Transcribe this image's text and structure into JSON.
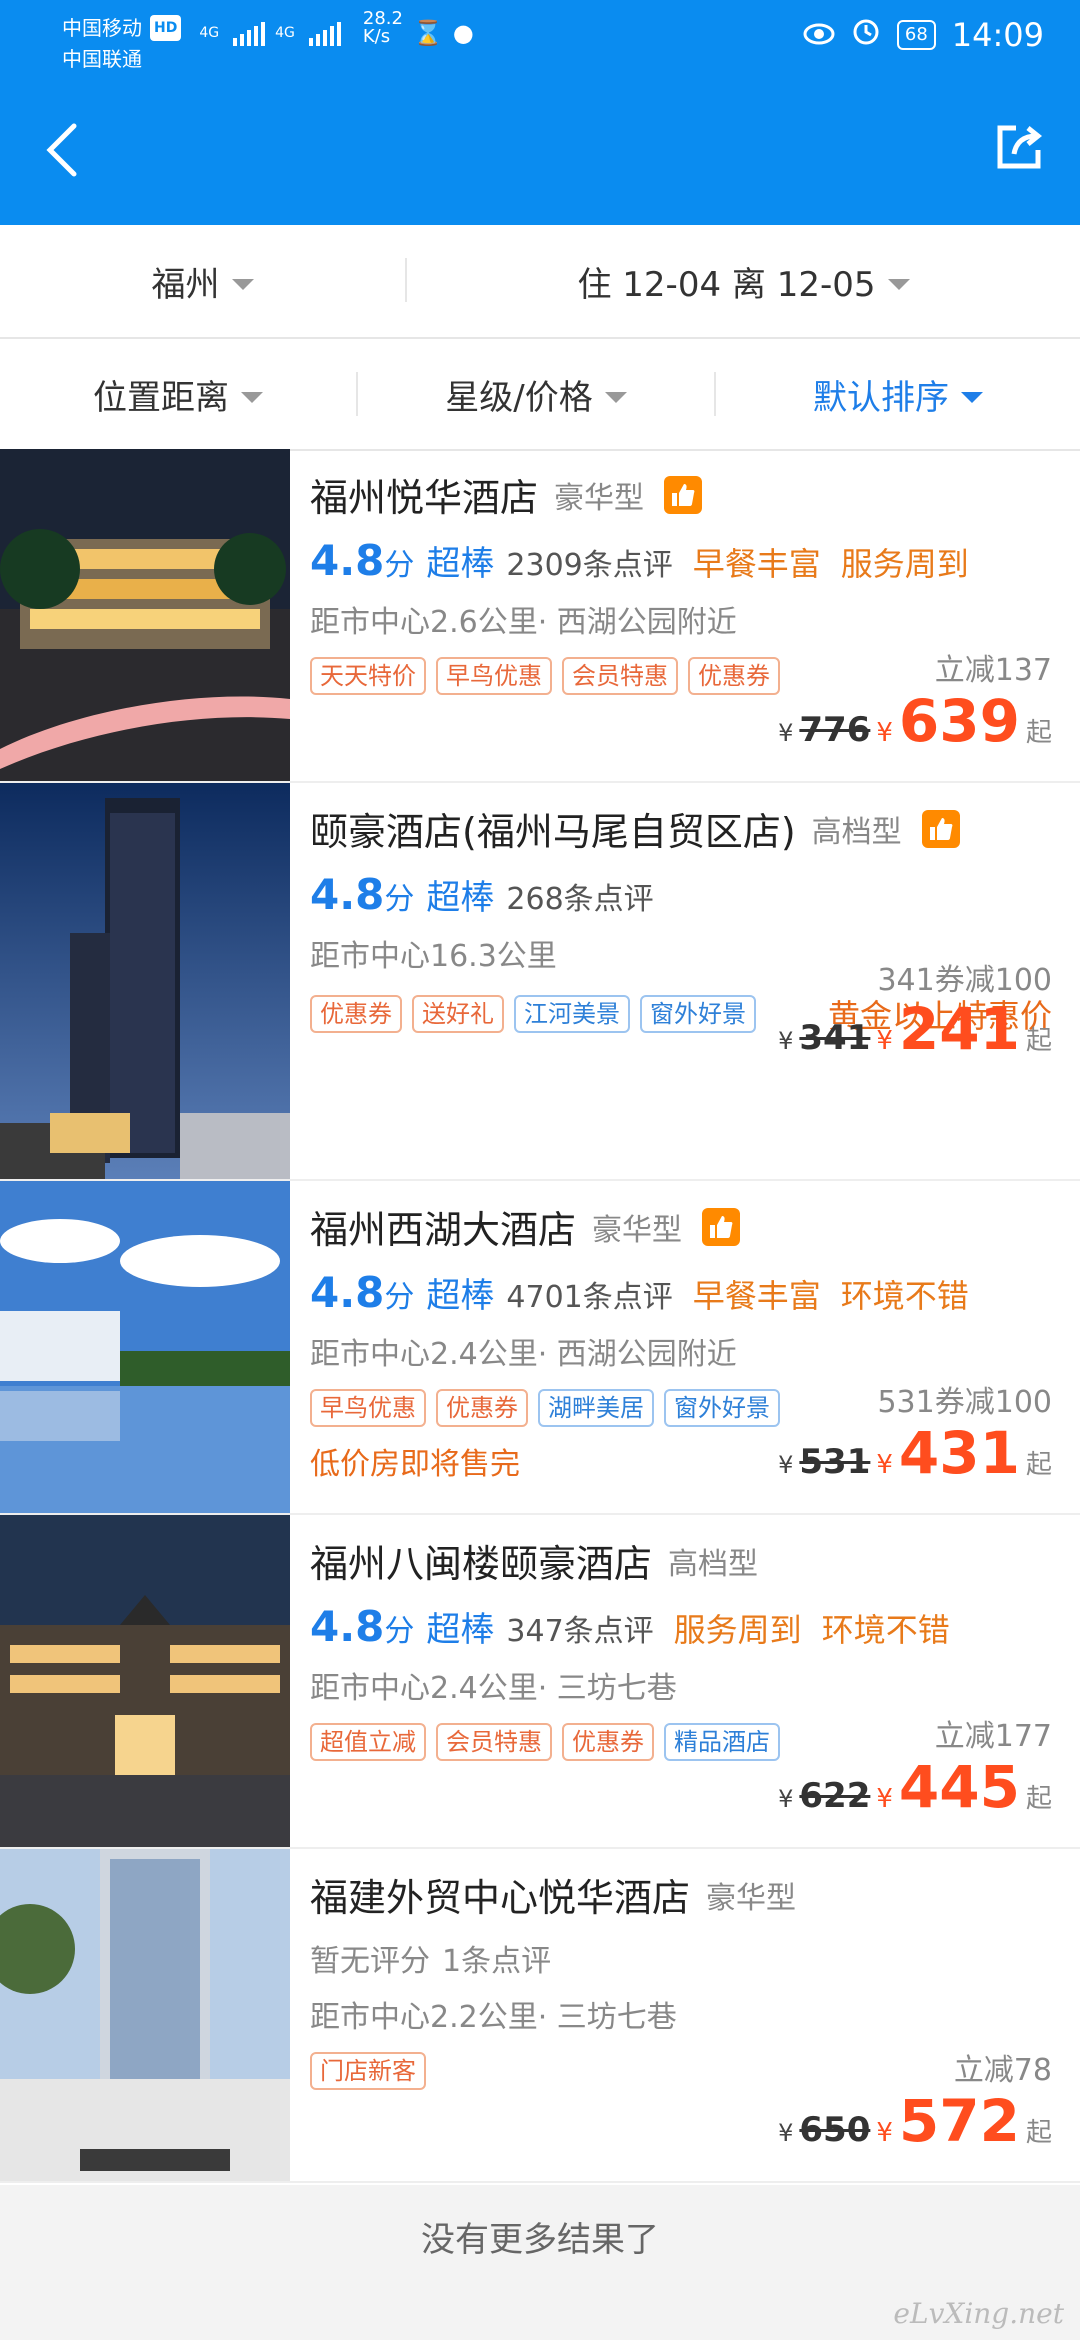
{
  "status": {
    "carrier1": "中国移动",
    "hd": "HD",
    "carrier2": "中国联通",
    "net1": "4G",
    "net2": "4G",
    "speed_value": "28.2",
    "speed_unit": "K/s",
    "battery": "68",
    "time": "14:09"
  },
  "filters": {
    "city": "福州",
    "dates": "住 12-04 离 12-05",
    "distance": "位置距离",
    "star_price": "星级/价格",
    "sort": "默认排序"
  },
  "hotels": [
    {
      "name": "福州悦华酒店",
      "grade": "豪华型",
      "score": "4.8",
      "score_unit": "分",
      "praise": "超棒",
      "reviews": "2309条点评",
      "features": [
        "早餐丰富",
        "服务周到"
      ],
      "distance": "距市中心2.6公里· 西湖公园附近",
      "tags": [
        "天天特价",
        "早鸟优惠",
        "会员特惠",
        "优惠券"
      ],
      "promo": "立减137",
      "old_price": "776",
      "price": "639"
    },
    {
      "name": "颐豪酒店(福州马尾自贸区店)",
      "grade": "高档型",
      "score": "4.8",
      "score_unit": "分",
      "praise": "超棒",
      "reviews": "268条点评",
      "distance": "距市中心16.3公里",
      "tags": [
        "优惠券",
        "送好礼",
        "江河美景",
        "窗外好景"
      ],
      "inline_promo": "黄金以上特惠价",
      "promo": "341券减100",
      "old_price": "341",
      "price": "241"
    },
    {
      "name": "福州西湖大酒店",
      "grade": "豪华型",
      "score": "4.8",
      "score_unit": "分",
      "praise": "超棒",
      "reviews": "4701条点评",
      "features": [
        "早餐丰富",
        "环境不错"
      ],
      "distance": "距市中心2.4公里· 西湖公园附近",
      "tags": [
        "早鸟优惠",
        "优惠券",
        "湖畔美居",
        "窗外好景"
      ],
      "promo": "531券减100",
      "sold_hint": "低价房即将售完",
      "old_price": "531",
      "price": "431"
    },
    {
      "name": "福州八闽楼颐豪酒店",
      "grade": "高档型",
      "score": "4.8",
      "score_unit": "分",
      "praise": "超棒",
      "reviews": "347条点评",
      "features": [
        "服务周到",
        "环境不错"
      ],
      "distance": "距市中心2.4公里· 三坊七巷",
      "tags": [
        "超值立减",
        "会员特惠",
        "优惠券",
        "精品酒店"
      ],
      "promo": "立减177",
      "old_price": "622",
      "price": "445"
    },
    {
      "name": "福建外贸中心悦华酒店",
      "grade": "豪华型",
      "no_score": "暂无评分",
      "reviews": "1条点评",
      "distance": "距市中心2.2公里· 三坊七巷",
      "tags": [
        "门店新客"
      ],
      "promo": "立减78",
      "old_price": "650",
      "price": "572"
    }
  ],
  "currency": "¥",
  "price_suffix": "起",
  "footer": {
    "message": "没有更多结果了",
    "watermark": "eLvXing.net"
  },
  "colors": {
    "primary": "#0a8cf0",
    "price": "#ff4d1e",
    "feature": "#e87a1a",
    "score": "#1e7ee8"
  }
}
